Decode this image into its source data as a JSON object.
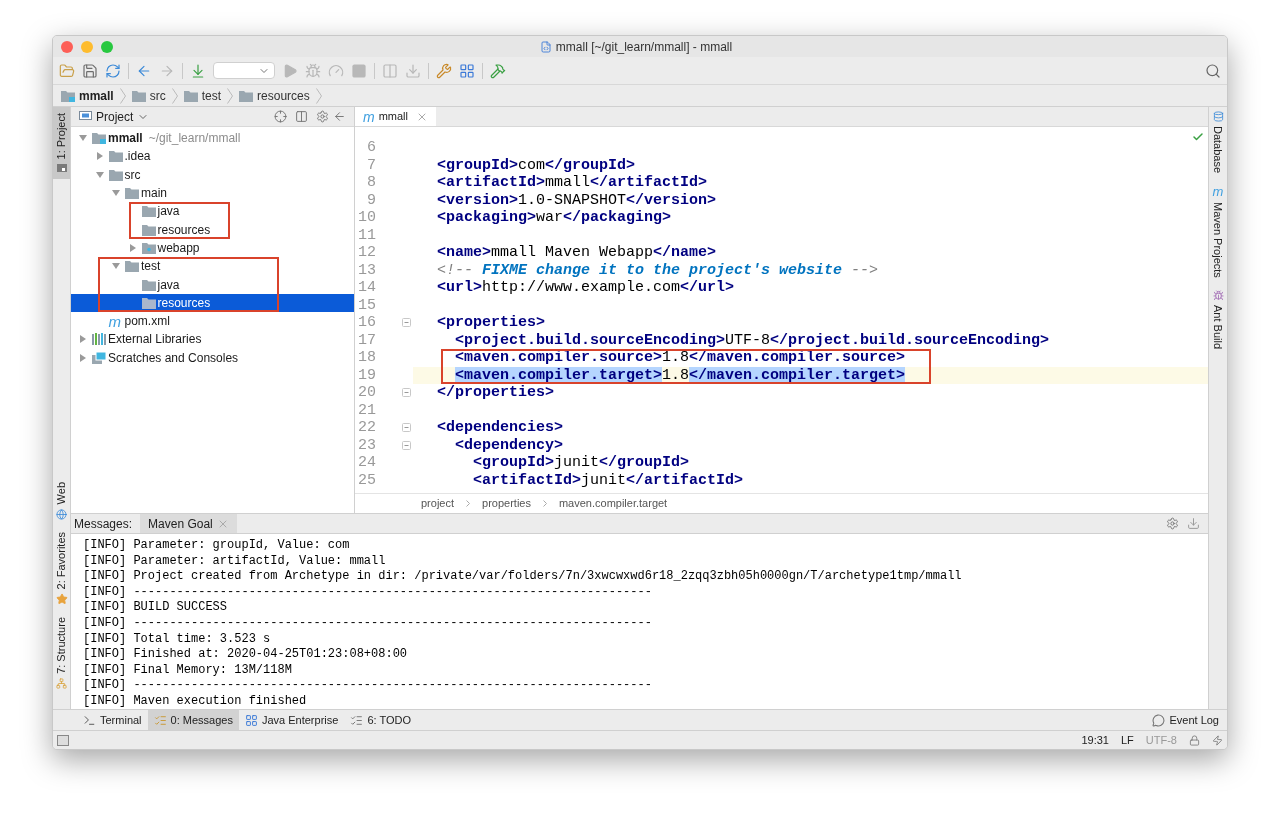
{
  "window": {
    "title": "mmall [~/git_learn/mmall] - mmall"
  },
  "breadcrumbs": [
    {
      "label": "mmall",
      "kind": "module"
    },
    {
      "label": "src",
      "kind": "folder"
    },
    {
      "label": "test",
      "kind": "folder"
    },
    {
      "label": "resources",
      "kind": "folder"
    }
  ],
  "project_panel": {
    "title": "Project",
    "tree": [
      {
        "label": "mmall",
        "path": "~/git_learn/mmall",
        "kind": "module",
        "expanded": true,
        "selected": false,
        "children": [
          {
            "label": ".idea",
            "kind": "folder",
            "expanded": false,
            "selected": false
          },
          {
            "label": "src",
            "kind": "folder",
            "expanded": true,
            "selected": false,
            "children": [
              {
                "label": "main",
                "kind": "folder",
                "expanded": true,
                "selected": false,
                "children": [
                  {
                    "label": "java",
                    "kind": "folder",
                    "selected": false,
                    "boxed": true
                  },
                  {
                    "label": "resources",
                    "kind": "folder",
                    "selected": false,
                    "boxed": true
                  },
                  {
                    "label": "webapp",
                    "kind": "web-folder",
                    "expanded": false,
                    "selected": false
                  }
                ]
              },
              {
                "label": "test",
                "kind": "folder",
                "expanded": true,
                "selected": false,
                "boxed": true,
                "children": [
                  {
                    "label": "java",
                    "kind": "folder",
                    "selected": false
                  },
                  {
                    "label": "resources",
                    "kind": "folder",
                    "selected": true
                  }
                ]
              }
            ]
          },
          {
            "label": "pom.xml",
            "kind": "pom",
            "icon": "m",
            "selected": false
          }
        ]
      },
      {
        "label": "External Libraries",
        "kind": "libraries",
        "expanded": false,
        "selected": false
      },
      {
        "label": "Scratches and Consoles",
        "kind": "scratches",
        "expanded": false,
        "selected": false
      }
    ]
  },
  "editor": {
    "tabs": [
      {
        "label": "mmall",
        "icon": "m",
        "selected": true
      }
    ],
    "lines": [
      {
        "number": "6"
      },
      {
        "number": "7",
        "segments": [
          {
            "kind": "tag",
            "text": "<groupId>"
          },
          {
            "kind": "text",
            "text": "com"
          },
          {
            "kind": "tag",
            "text": "</groupId>"
          }
        ]
      },
      {
        "number": "8",
        "segments": [
          {
            "kind": "tag",
            "text": "<artifactId>"
          },
          {
            "kind": "text",
            "text": "mmall"
          },
          {
            "kind": "tag",
            "text": "</artifactId>"
          }
        ]
      },
      {
        "number": "9",
        "segments": [
          {
            "kind": "tag",
            "text": "<version>"
          },
          {
            "kind": "text",
            "text": "1.0-SNAPSHOT"
          },
          {
            "kind": "tag",
            "text": "</version>"
          }
        ]
      },
      {
        "number": "10",
        "segments": [
          {
            "kind": "tag",
            "text": "<packaging>"
          },
          {
            "kind": "text",
            "text": "war"
          },
          {
            "kind": "tag",
            "text": "</packaging>"
          }
        ]
      },
      {
        "number": "11"
      },
      {
        "number": "12",
        "segments": [
          {
            "kind": "tag",
            "text": "<name>"
          },
          {
            "kind": "text",
            "text": "mmall Maven Webapp"
          },
          {
            "kind": "tag",
            "text": "</name>"
          }
        ]
      },
      {
        "number": "13",
        "segments": [
          {
            "kind": "comment",
            "text": "<!-- "
          },
          {
            "kind": "todo",
            "text": "FIXME change it to the project's website"
          },
          {
            "kind": "comment",
            "text": " -->"
          }
        ]
      },
      {
        "number": "14",
        "segments": [
          {
            "kind": "tag",
            "text": "<url>"
          },
          {
            "kind": "text",
            "text": "http://www.example.com"
          },
          {
            "kind": "tag",
            "text": "</url>"
          }
        ]
      },
      {
        "number": "15"
      },
      {
        "number": "16",
        "fold_marker": true,
        "segments": [
          {
            "kind": "tag",
            "text": "<properties>"
          }
        ]
      },
      {
        "number": "17",
        "segments": [
          {
            "kind": "tag",
            "text": "  <project.build.sourceEncoding>"
          },
          {
            "kind": "text",
            "text": "UTF-8"
          },
          {
            "kind": "tag",
            "text": "</project.build.sourceEncoding>"
          }
        ]
      },
      {
        "number": "18",
        "boxed": true,
        "segments": [
          {
            "kind": "tag",
            "text": "  <maven.compiler.source>"
          },
          {
            "kind": "text",
            "text": "1.8"
          },
          {
            "kind": "tag",
            "text": "</maven.compiler.source>"
          }
        ]
      },
      {
        "number": "19",
        "boxed": true,
        "current": true,
        "segments": [
          {
            "kind": "tag",
            "text": "  <maven.compiler.target>",
            "highlighted": true
          },
          {
            "kind": "text",
            "text": "1.8"
          },
          {
            "kind": "tag",
            "text": "</maven.compiler.target>",
            "highlighted": true
          }
        ]
      },
      {
        "number": "20",
        "fold_marker": true,
        "segments": [
          {
            "kind": "tag",
            "text": "</properties>"
          }
        ]
      },
      {
        "number": "21"
      },
      {
        "number": "22",
        "fold_marker": true,
        "segments": [
          {
            "kind": "tag",
            "text": "<dependencies>"
          }
        ]
      },
      {
        "number": "23",
        "fold_marker": true,
        "segments": [
          {
            "kind": "tag",
            "text": "  <dependency>"
          }
        ]
      },
      {
        "number": "24",
        "segments": [
          {
            "kind": "tag",
            "text": "    <groupId>"
          },
          {
            "kind": "text",
            "text": "junit"
          },
          {
            "kind": "tag",
            "text": "</groupId>"
          }
        ]
      },
      {
        "number": "25",
        "segments": [
          {
            "kind": "tag",
            "text": "    <artifactId>"
          },
          {
            "kind": "text",
            "text": "junit"
          },
          {
            "kind": "tag",
            "text": "</artifactId>"
          }
        ]
      }
    ],
    "breadcrumb": [
      "project",
      "properties",
      "maven.compiler.target"
    ]
  },
  "left_stripe": [
    {
      "label": "1: Project",
      "kind": "project",
      "selected": true
    },
    {
      "label": "Web",
      "kind": "web",
      "selected": false
    },
    {
      "label": "2: Favorites",
      "kind": "favorites",
      "selected": false
    },
    {
      "label": "7: Structure",
      "kind": "structure",
      "selected": false
    }
  ],
  "right_stripe": [
    {
      "label": "Database",
      "kind": "database"
    },
    {
      "label": "Maven Projects",
      "kind": "maven",
      "icon": "m"
    },
    {
      "label": "Ant Build",
      "kind": "ant"
    }
  ],
  "messages": {
    "label": "Messages:",
    "tabs": [
      {
        "label": "Maven Goal",
        "selected": true
      }
    ],
    "lines": [
      "[INFO] Parameter: groupId, Value: com",
      "[INFO] Parameter: artifactId, Value: mmall",
      "[INFO] Project created from Archetype in dir: /private/var/folders/7n/3xwcwxwd6r18_2zqq3zbh05h0000gn/T/archetype1tmp/mmall",
      "[INFO] ------------------------------------------------------------------------",
      "[INFO] BUILD SUCCESS",
      "[INFO] ------------------------------------------------------------------------",
      "[INFO] Total time: 3.523 s",
      "[INFO] Finished at: 2020-04-25T01:23:08+08:00",
      "[INFO] Final Memory: 13M/118M",
      "[INFO] ------------------------------------------------------------------------",
      "[INFO] Maven execution finished"
    ]
  },
  "bottom_tabs": [
    {
      "label": "Terminal",
      "kind": "terminal",
      "selected": false
    },
    {
      "label": "0: Messages",
      "kind": "messages",
      "selected": true
    },
    {
      "label": "Java Enterprise",
      "kind": "java-enterprise",
      "selected": false
    },
    {
      "label": "6: TODO",
      "kind": "todo",
      "selected": false
    }
  ],
  "event_log": "Event Log",
  "status_bar": {
    "position": "19:31",
    "line_separator": "LF",
    "encoding": "UTF-8"
  }
}
